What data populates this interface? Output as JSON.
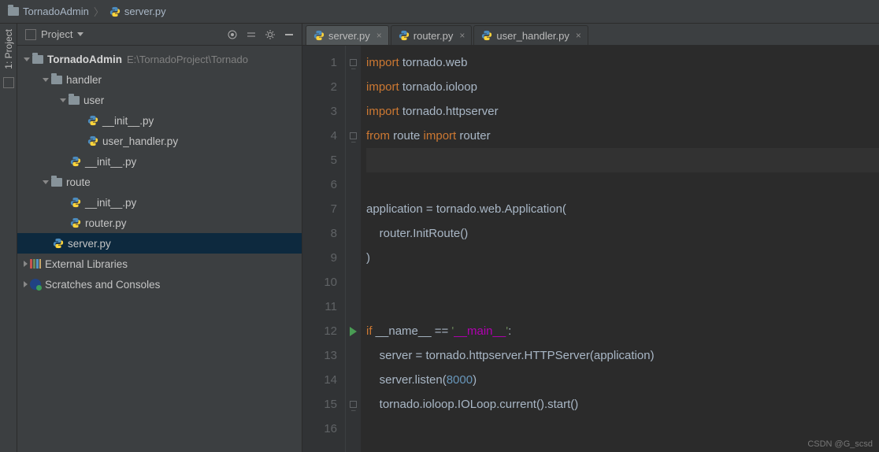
{
  "breadcrumb": {
    "project": "TornadoAdmin",
    "file": "server.py"
  },
  "sidebar": {
    "label": "1: Project"
  },
  "project_panel": {
    "title": "Project"
  },
  "tree": {
    "root": {
      "name": "TornadoAdmin",
      "path": "E:\\TornadoProject\\Tornado"
    },
    "handler": {
      "name": "handler"
    },
    "user": {
      "name": "user"
    },
    "user_init": {
      "name": "__init__.py"
    },
    "user_handler": {
      "name": "user_handler.py"
    },
    "handler_init": {
      "name": "__init__.py"
    },
    "route": {
      "name": "route"
    },
    "route_init": {
      "name": "__init__.py"
    },
    "router_py": {
      "name": "router.py"
    },
    "server_py": {
      "name": "server.py"
    },
    "external": {
      "name": "External Libraries"
    },
    "scratches": {
      "name": "Scratches and Consoles"
    }
  },
  "tabs": [
    {
      "label": "server.py"
    },
    {
      "label": "router.py"
    },
    {
      "label": "user_handler.py"
    }
  ],
  "code": {
    "l1": {
      "kw": "import",
      "id": "tornado.web"
    },
    "l2": {
      "kw": "import",
      "id": "tornado.ioloop"
    },
    "l3": {
      "kw": "import",
      "id": "tornado.httpserver"
    },
    "l4": {
      "kw1": "from",
      "id1": "route",
      "kw2": "import",
      "id2": "router"
    },
    "l7": "application = tornado.web.Application(",
    "l8": "    router.InitRoute()",
    "l9": ")",
    "l12": {
      "kw": "if",
      "d1": " __name__ ",
      "op": "== ",
      "s1": "'",
      "du": "__main__",
      "s2": "'",
      "tail": ":"
    },
    "l13": {
      "pre": "    server = tornado.httpserver.",
      "cls": "HTTPServer",
      "post": "(application)"
    },
    "l14": {
      "pre": "    server.listen(",
      "num": "8000",
      "post": ")"
    },
    "l15": "    tornado.ioloop.IOLoop.current().start()"
  },
  "lineno": [
    "1",
    "2",
    "3",
    "4",
    "5",
    "6",
    "7",
    "8",
    "9",
    "10",
    "11",
    "12",
    "13",
    "14",
    "15",
    "16"
  ],
  "watermark": "CSDN @G_scsd"
}
